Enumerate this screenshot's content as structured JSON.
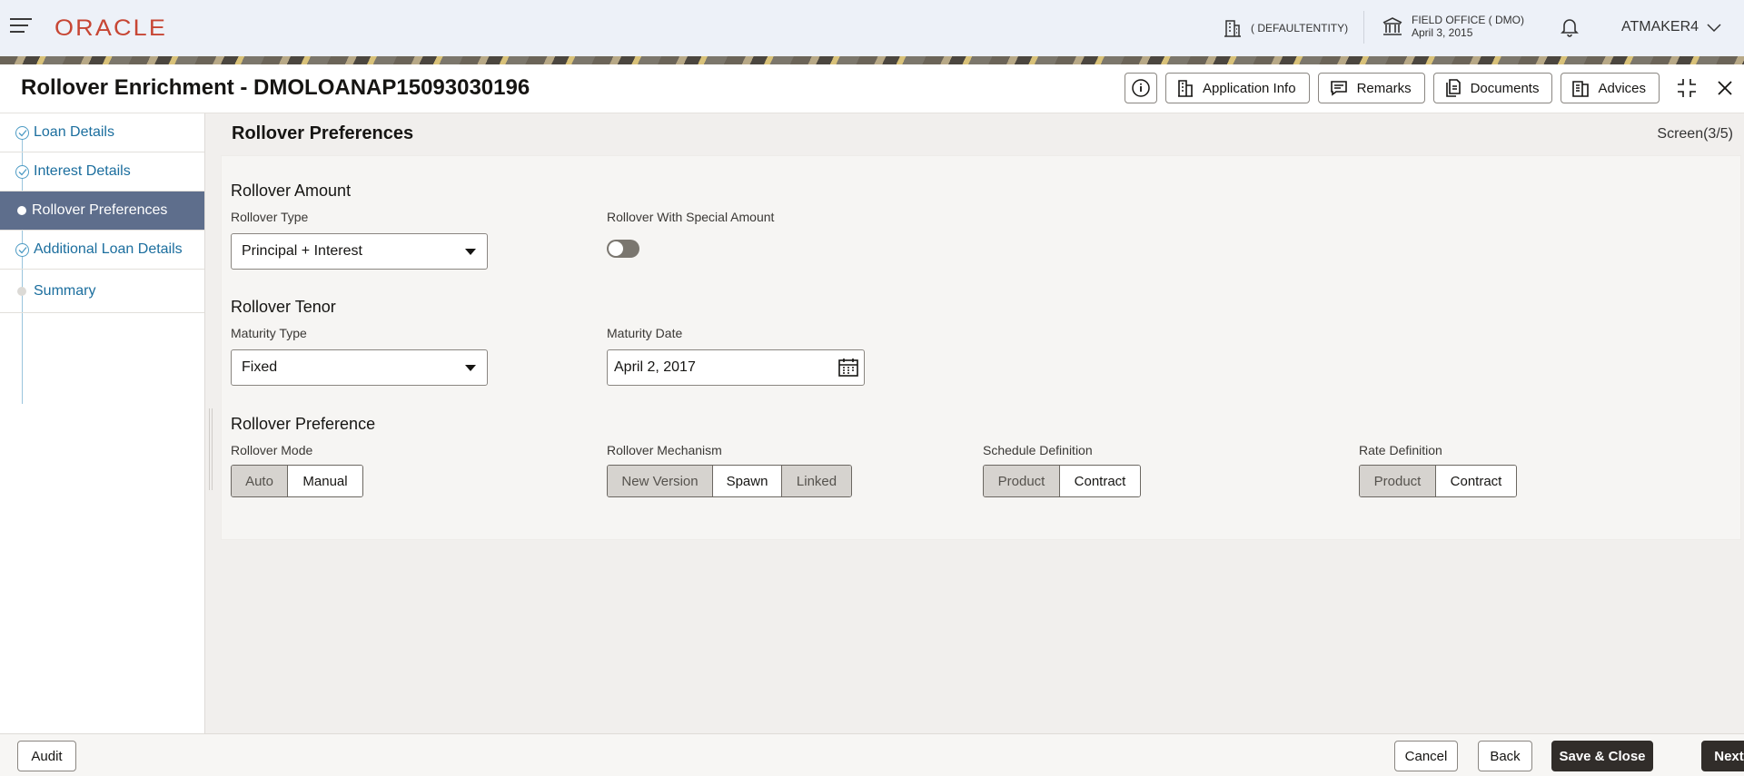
{
  "header": {
    "logo": "ORACLE",
    "entity": "( DEFAULTENTITY)",
    "office_name": "FIELD OFFICE ( DMO)",
    "office_date": "April 3, 2015",
    "user": "ATMAKER4"
  },
  "titlebar": {
    "title": "Rollover Enrichment - DMOLOANAP15093030196",
    "buttons": [
      "Application Info",
      "Remarks",
      "Documents",
      "Advices"
    ]
  },
  "nav": {
    "items": [
      {
        "label": "Loan Details",
        "state": "done"
      },
      {
        "label": "Interest Details",
        "state": "done"
      },
      {
        "label": "Rollover Preferences",
        "state": "active"
      },
      {
        "label": "Additional Loan Details",
        "state": "done"
      },
      {
        "label": "Summary",
        "state": "pending"
      }
    ]
  },
  "main": {
    "title": "Rollover Preferences",
    "screen": "Screen(3/5)",
    "amount": {
      "title": "Rollover Amount",
      "type_label": "Rollover Type",
      "type_value": "Principal + Interest",
      "special_label": "Rollover With Special Amount"
    },
    "tenor": {
      "title": "Rollover Tenor",
      "maturity_type_label": "Maturity Type",
      "maturity_type_value": "Fixed",
      "maturity_date_label": "Maturity Date",
      "maturity_date_value": "April 2, 2017"
    },
    "preference": {
      "title": "Rollover Preference",
      "mode_label": "Rollover Mode",
      "mode_options": [
        "Auto",
        "Manual"
      ],
      "mechanism_label": "Rollover Mechanism",
      "mechanism_options": [
        "New Version",
        "Spawn",
        "Linked"
      ],
      "schedule_label": "Schedule Definition",
      "schedule_options": [
        "Product",
        "Contract"
      ],
      "rate_label": "Rate Definition",
      "rate_options": [
        "Product",
        "Contract"
      ]
    }
  },
  "footer": {
    "audit": "Audit",
    "cancel": "Cancel",
    "back": "Back",
    "save_close": "Save & Close",
    "next": "Next"
  },
  "colors": {
    "brand": "#c74634",
    "nav_active": "#5e6e8c",
    "link": "#1b6e9e",
    "dark_button": "#312d2a"
  }
}
